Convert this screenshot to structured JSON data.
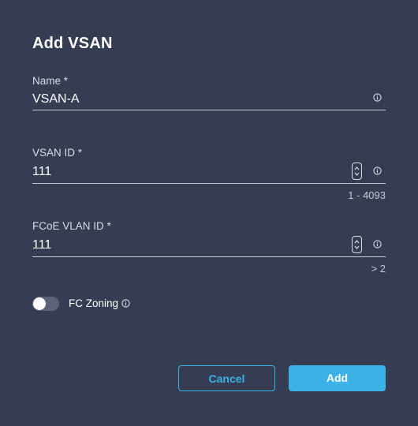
{
  "dialog": {
    "title": "Add VSAN",
    "name_field": {
      "label": "Name *",
      "value": "VSAN-A",
      "icon": "info-icon"
    },
    "vsan_id_field": {
      "label": "VSAN ID *",
      "value": "111",
      "hint": "1 - 4093",
      "icon": "info-icon"
    },
    "fcoe_vlan_field": {
      "label": "FCoE VLAN ID *",
      "value": "111",
      "hint": "> 2",
      "icon": "info-icon"
    },
    "fc_zoning": {
      "label": "FC Zoning",
      "enabled": false
    },
    "buttons": {
      "cancel": "Cancel",
      "add": "Add"
    }
  },
  "colors": {
    "background": "#353d52",
    "accent": "#3cb1e6",
    "underline": "#c5cad6",
    "toggle_off": "#5b6479"
  }
}
